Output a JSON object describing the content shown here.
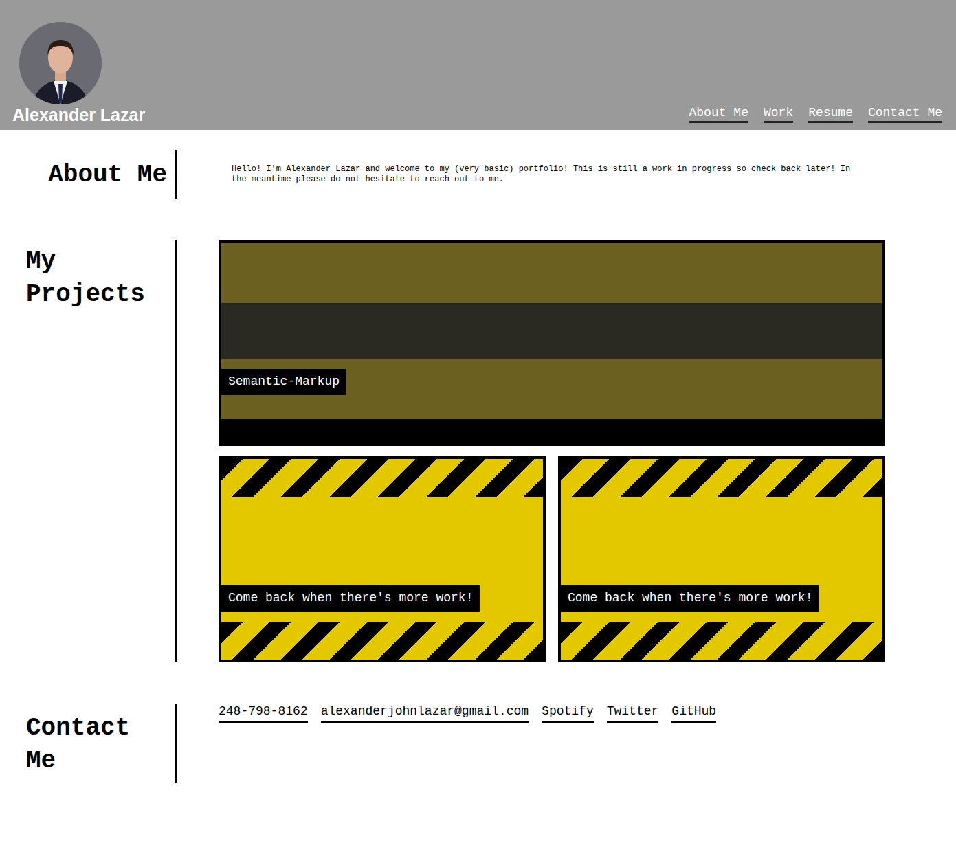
{
  "header": {
    "name": "Alexander Lazar",
    "nav": [
      "About Me",
      "Work",
      "Resume",
      "Contact Me"
    ]
  },
  "about": {
    "heading": "About Me",
    "text": "Hello! I'm Alexander Lazar and welcome to my (very basic) portfolio! This is still a work in progress so check back later! In the meantime please do not hesitate to reach out to me."
  },
  "projects": {
    "heading": "My Projects",
    "items": [
      {
        "caption": "Semantic-Markup",
        "kind": "photo"
      },
      {
        "caption": "Come back when there's more work!",
        "kind": "construction"
      },
      {
        "caption": "Come back when there's more work!",
        "kind": "construction"
      }
    ]
  },
  "contact": {
    "heading": "Contact Me",
    "links": [
      "248-798-8162",
      "alexanderjohnlazar@gmail.com",
      "Spotify",
      "Twitter",
      "GitHub"
    ]
  }
}
